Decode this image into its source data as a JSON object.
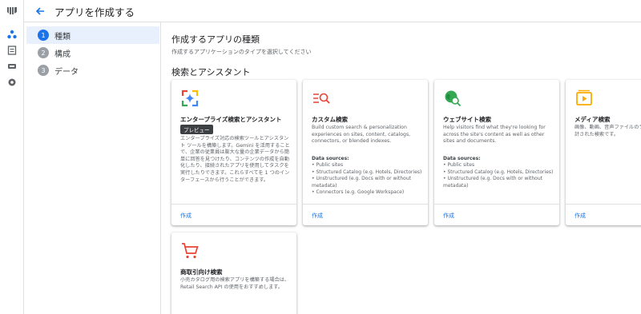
{
  "header": {
    "title": "アプリを作成する"
  },
  "steps": [
    {
      "num": "1",
      "label": "種類"
    },
    {
      "num": "2",
      "label": "構成"
    },
    {
      "num": "3",
      "label": "データ"
    }
  ],
  "main": {
    "heading": "作成するアプリの種類",
    "subheading": "作成するアプリケーションのタイプを選択してください",
    "section": "検索とアシスタント"
  },
  "cards": {
    "enterprise": {
      "title": "エンタープライズ検索とアシスタント",
      "badge": "プレビュー",
      "desc": "エンタープライズ対応の検索ツールとアシスタント ツールを構築します。Gemini を活用することで、企業の従業員は膨大な量の企業データから簡単に回答を見つけたり、コンテンツの作成を自動化したり、接続されたアプリを使用してタスクを実行したりできます。これらすべてを 1 つのインターフェースから行うことができます。",
      "create": "作成"
    },
    "custom": {
      "title": "カスタム検索",
      "desc": "Build custom search & personalization experiences on sites, content, catalogs, connectors, or blended indexes.",
      "ds_head": "Data sources:",
      "ds": [
        "• Public sites",
        "• Structured Catalog (e.g. Hotels, Directories)",
        "• Unstructured (e.g. Docs with or without metadata)",
        "• Connectors (e.g. Google Workspace)"
      ],
      "create": "作成"
    },
    "website": {
      "title": "ウェブサイト検索",
      "desc": "Help visitors find what they're looking for across the site's content as well as other sites and documents.",
      "ds_head": "Data sources:",
      "ds": [
        "• Public sites",
        "• Structured Catalog (e.g. Hotels, Directories)",
        "• Unstructured (e.g. Docs with or without metadata)"
      ],
      "create": "作成"
    },
    "media": {
      "title": "メディア検索",
      "desc": "画像、動画、音声ファイルのライブラリ向けに設計された検索です。",
      "create": "作成"
    },
    "commerce": {
      "title": "商取引向け検索",
      "desc": "小売カタログ用の検索アプリを構築する場合は、Retail Search API の使用をおすすめします。"
    }
  },
  "colors": {
    "accent": "#1a73e8",
    "badge_bg": "#3c4043"
  }
}
